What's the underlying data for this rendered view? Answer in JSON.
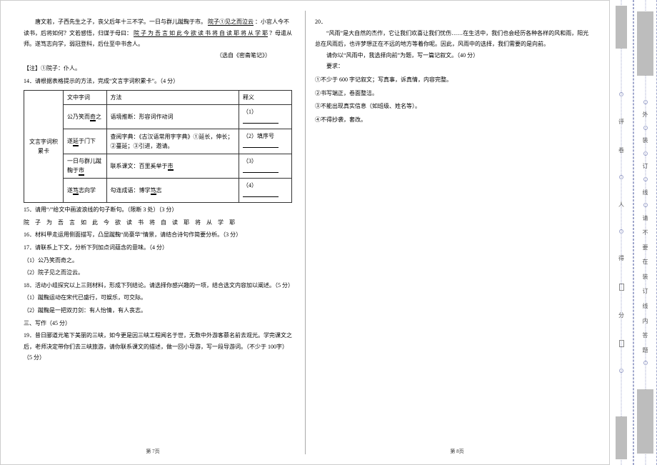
{
  "left": {
    "intro_a": "唐文若，子西先生之子，丧父后年十三不学。一日与群儿蹴鞠于市。",
    "intro_u1": "院子①见之而泣云",
    "intro_b": "：小官人今不读书，后将如何？文若感悟，归谋于母曰：",
    "intro_u2": "院 子 为 吾 言 如 此 今 欲 读 书 将 自 读 耶 将 从 学 耶",
    "intro_c": "？母遣从师。遂笃志向学，弱冠登科，后仕至中书舍人。",
    "source": "（选自《密斋笔记》）",
    "note": "【注】①院子：仆人。",
    "q14": "14．请根据表格提示的方法，完成“文言字词积累卡”。（4 分）",
    "tbl": {
      "rowh": "文言字词积累卡",
      "head": [
        "文中字词",
        "方法",
        "释义"
      ],
      "rows": [
        [
          "公乃笑而奇之",
          "语境推断：形容词作动词",
          "（1）"
        ],
        [
          "遂延于门下",
          "查阅字典：《古汉语常用字字典》①延长，伸长；②蔓延；③引进，邀请。",
          "（2）填序号"
        ],
        [
          "一日与群儿蹴鞠于市",
          "联系课文：百里奚举于市",
          "（3）"
        ],
        [
          "遂笃志向学",
          "勾连成语：博学笃志",
          "（4）"
        ]
      ]
    },
    "q15": "15．请用“/”给文中画波浪线的句子断句。（限断 3 处）（3 分）",
    "q15s": "院 子 为 吾 言 如 此 今 欲 读 书 将 自 读 耶 将 从 学 耶",
    "q16": "16．材料甲走运用侧面描写，凸显蹴鞠“尚豪华”情景，请结合诗句作简要分析。（3 分）",
    "q17": "17．请联系上下文，分析下列加点词蕴含的意味。（4 分）",
    "q17a": "（1）公乃笑而奇之。",
    "q17b": "（2）院子见之而泣云。",
    "q18": "18．活动小组探究以上三则材料，形成下列结论。请选择你感兴趣的一项，结合选文内容加以阐述。（5 分）",
    "q18a": "（1）蹴鞠运动在宋代已盛行，可娱乐，可交际。",
    "q18b": "（2）蹴鞠是一把双刃剑：有人怡情，有人丧志。",
    "sec": "三、写作（45 分）",
    "q19": "19．昔日郦道元笔下美丽的三峡，如今更是因三峡工程闻名于世，无数中外游客慕名前去观光。学完课文之后，老师决定带你们去三峡旅游，请你联系课文的描述，做一回小导游，写一段导游词。（不少于 100字）（5 分）",
    "pgnum": "第 7页"
  },
  "right": {
    "q20n": "20．",
    "q20a": "“风雨”是大自然的杰作，它让我们欢喜让我们忧伤……在生活中，我们也会经历各种各样的风和雨，阳光总在风雨后，也许梦想正在不远的地方等着你呢。因此，风雨中的选择，我们需要的是向前。",
    "q20b": "请你以“风雨中，我选择向前”为题，写一篇记叙文。（40 分）",
    "req": "要求：",
    "r1": "①不少于 600 字记叙文；写真事，诉真情，内容完整。",
    "r2": "②书写端正，卷面整洁。",
    "r3": "③不能出现真实信息（如班级、姓名等）。",
    "r4": "④不得抄袭，套改。",
    "pgnum": "第 8页"
  },
  "spine": {
    "inner": [
      "评",
      "卷",
      "人",
      "得",
      "分"
    ],
    "outer": [
      "外",
      "装",
      "订",
      "线",
      "请",
      "不",
      "要",
      "在",
      "装",
      "订",
      "线",
      "内",
      "答",
      "题"
    ]
  }
}
